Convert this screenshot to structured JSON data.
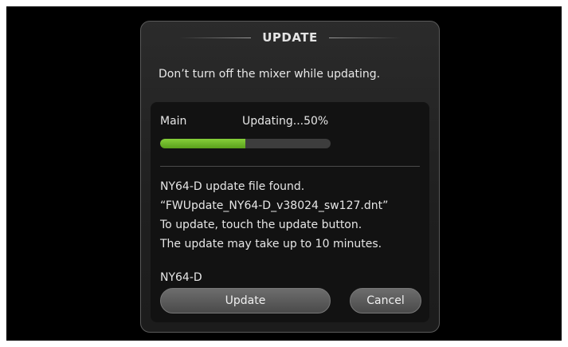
{
  "dialog": {
    "title": "UPDATE",
    "warning": "Don’t turn off the mixer while updating."
  },
  "progress": {
    "target": "Main",
    "status": "Updating...50%",
    "fraction": 0.5,
    "fill_color": "#6dbb28"
  },
  "info_lines": [
    "NY64-D update file found.",
    "“FWUpdate_NY64-D_v38024_sw127.dnt”",
    "To update, touch the update button.",
    "The update may take up to 10 minutes."
  ],
  "device": "NY64-D",
  "buttons": {
    "update_label": "Update",
    "cancel_label": "Cancel"
  }
}
